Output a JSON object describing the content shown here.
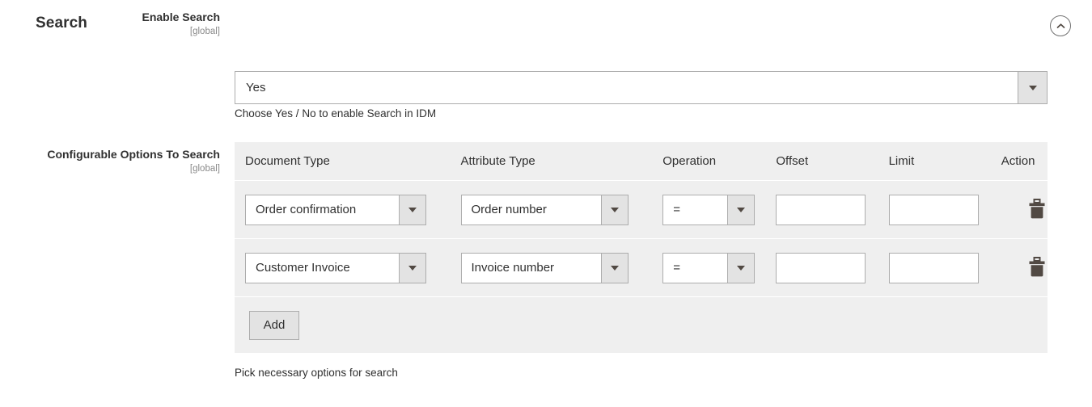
{
  "section": {
    "title": "Search",
    "collapse_icon": "chevron-up-circle-icon"
  },
  "enable_search": {
    "label": "Enable Search",
    "scope": "[global]",
    "value": "Yes",
    "note": "Choose Yes / No to enable Search in IDM"
  },
  "configurable_options": {
    "label": "Configurable Options To Search",
    "scope": "[global]",
    "note": "Pick necessary options for search",
    "add_label": "Add",
    "columns": [
      "Document Type",
      "Attribute Type",
      "Operation",
      "Offset",
      "Limit",
      "Action"
    ],
    "rows": [
      {
        "document_type": "Order confirmation",
        "attribute_type": "Order number",
        "operation": "=",
        "offset": "",
        "limit": "",
        "delete_icon": "trash-icon"
      },
      {
        "document_type": "Customer Invoice",
        "attribute_type": "Invoice number",
        "operation": "=",
        "offset": "",
        "limit": "",
        "delete_icon": "trash-icon"
      }
    ]
  },
  "colors": {
    "table_bg": "#efefef",
    "control_bg": "#e3e3e3",
    "border": "#adadad",
    "text": "#303030",
    "scope_text": "#8a8a8a",
    "icon": "#514943"
  }
}
